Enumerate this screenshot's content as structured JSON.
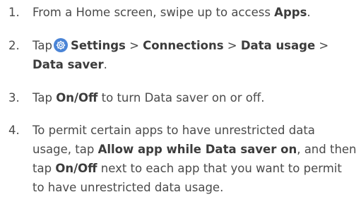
{
  "steps": [
    {
      "num": "1.",
      "t1": "From a Home screen, swipe up to access ",
      "b1": "Apps",
      "t2": "."
    },
    {
      "num": "2.",
      "t1": "Tap",
      "b1": "Settings",
      "sep1": " > ",
      "b2": "Connections",
      "sep2": " > ",
      "b3": "Data usage",
      "sep3": " >",
      "b4": "Data saver",
      "t2": ".",
      "icon": "settings-gear-icon"
    },
    {
      "num": "3.",
      "t1": "Tap ",
      "b1": "On/Off",
      "t2": " to turn Data saver on or off."
    },
    {
      "num": "4.",
      "t1": "To permit certain apps to have unrestricted data usage, tap ",
      "b1": "Allow app while Data saver on",
      "t2": ", and then tap ",
      "b2": "On/Off",
      "t3": " next to each app that you want to permit to have unrestricted data usage."
    }
  ],
  "colors": {
    "text": "#4a4a4a",
    "bold_text": "#3c3c3c",
    "icon_background": "#4a84d6"
  }
}
